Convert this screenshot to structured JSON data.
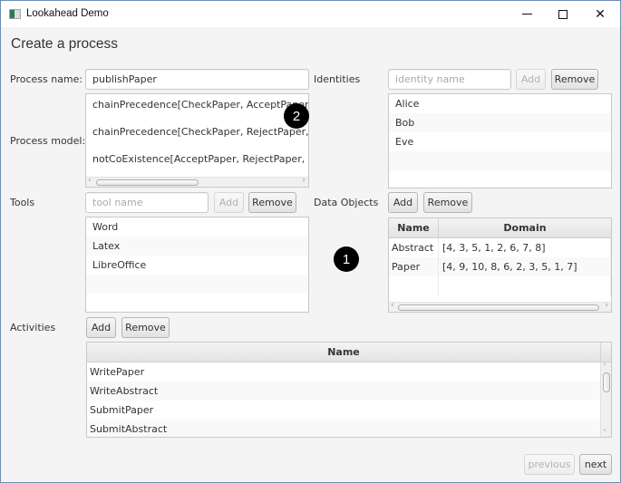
{
  "window": {
    "title": "Lookahead Demo",
    "icon": "app-window-icon",
    "controls": {
      "minimize": "minimize-icon",
      "maximize": "maximize-icon",
      "close": "close-icon",
      "close_glyph": "✕"
    }
  },
  "heading": "Create a process",
  "process_name": {
    "label": "Process name:",
    "value": "publishPaper"
  },
  "process_model": {
    "label": "Process model:",
    "lines": [
      "chainPrecedence[CheckPaper, AcceptPaper, (",
      "chainPrecedence[CheckPaper, RejectPaper, (",
      "notCoExistence[AcceptPaper, RejectPaper,"
    ],
    "scroll_left": "‹",
    "scroll_right": "›"
  },
  "identities": {
    "label": "Identities",
    "placeholder": "identity name",
    "add_label": "Add",
    "remove_label": "Remove",
    "items": [
      "Alice",
      "Bob",
      "Eve",
      "",
      ""
    ]
  },
  "tools": {
    "label": "Tools",
    "placeholder": "tool name",
    "add_label": "Add",
    "remove_label": "Remove",
    "items": [
      "Word",
      "Latex",
      "LibreOffice",
      "",
      ""
    ]
  },
  "data_objects": {
    "label": "Data Objects",
    "add_label": "Add",
    "remove_label": "Remove",
    "columns": [
      "Name",
      "Domain"
    ],
    "rows": [
      {
        "name": "Abstract",
        "domain": "[4, 3, 5, 1, 2, 6, 7, 8]"
      },
      {
        "name": "Paper",
        "domain": "[4, 9, 10, 8, 6, 2, 3, 5, 1, 7]"
      },
      {
        "name": "",
        "domain": ""
      }
    ],
    "scroll_left": "‹",
    "scroll_right": "›"
  },
  "activities": {
    "label": "Activities",
    "add_label": "Add",
    "remove_label": "Remove",
    "column": "Name",
    "rows": [
      "WritePaper",
      "WriteAbstract",
      "SubmitPaper",
      "SubmitAbstract"
    ],
    "scroll_up": "˄",
    "scroll_down": "˅"
  },
  "annotations": {
    "badge_1": "1",
    "badge_2": "2"
  },
  "navigation": {
    "previous_label": "previous",
    "next_label": "next"
  }
}
